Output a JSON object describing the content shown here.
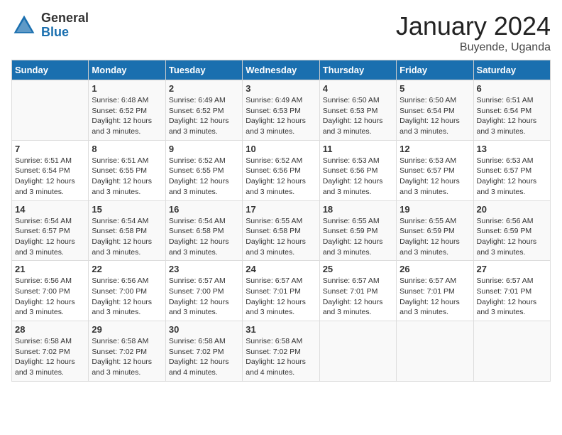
{
  "header": {
    "logo_general": "General",
    "logo_blue": "Blue",
    "month_year": "January 2024",
    "location": "Buyende, Uganda"
  },
  "days_of_week": [
    "Sunday",
    "Monday",
    "Tuesday",
    "Wednesday",
    "Thursday",
    "Friday",
    "Saturday"
  ],
  "weeks": [
    [
      {
        "day": "",
        "content": ""
      },
      {
        "day": "1",
        "content": "Sunrise: 6:48 AM\nSunset: 6:52 PM\nDaylight: 12 hours\nand 3 minutes."
      },
      {
        "day": "2",
        "content": "Sunrise: 6:49 AM\nSunset: 6:52 PM\nDaylight: 12 hours\nand 3 minutes."
      },
      {
        "day": "3",
        "content": "Sunrise: 6:49 AM\nSunset: 6:53 PM\nDaylight: 12 hours\nand 3 minutes."
      },
      {
        "day": "4",
        "content": "Sunrise: 6:50 AM\nSunset: 6:53 PM\nDaylight: 12 hours\nand 3 minutes."
      },
      {
        "day": "5",
        "content": "Sunrise: 6:50 AM\nSunset: 6:54 PM\nDaylight: 12 hours\nand 3 minutes."
      },
      {
        "day": "6",
        "content": "Sunrise: 6:51 AM\nSunset: 6:54 PM\nDaylight: 12 hours\nand 3 minutes."
      }
    ],
    [
      {
        "day": "7",
        "content": "Sunrise: 6:51 AM\nSunset: 6:54 PM\nDaylight: 12 hours\nand 3 minutes."
      },
      {
        "day": "8",
        "content": "Sunrise: 6:51 AM\nSunset: 6:55 PM\nDaylight: 12 hours\nand 3 minutes."
      },
      {
        "day": "9",
        "content": "Sunrise: 6:52 AM\nSunset: 6:55 PM\nDaylight: 12 hours\nand 3 minutes."
      },
      {
        "day": "10",
        "content": "Sunrise: 6:52 AM\nSunset: 6:56 PM\nDaylight: 12 hours\nand 3 minutes."
      },
      {
        "day": "11",
        "content": "Sunrise: 6:53 AM\nSunset: 6:56 PM\nDaylight: 12 hours\nand 3 minutes."
      },
      {
        "day": "12",
        "content": "Sunrise: 6:53 AM\nSunset: 6:57 PM\nDaylight: 12 hours\nand 3 minutes."
      },
      {
        "day": "13",
        "content": "Sunrise: 6:53 AM\nSunset: 6:57 PM\nDaylight: 12 hours\nand 3 minutes."
      }
    ],
    [
      {
        "day": "14",
        "content": "Sunrise: 6:54 AM\nSunset: 6:57 PM\nDaylight: 12 hours\nand 3 minutes."
      },
      {
        "day": "15",
        "content": "Sunrise: 6:54 AM\nSunset: 6:58 PM\nDaylight: 12 hours\nand 3 minutes."
      },
      {
        "day": "16",
        "content": "Sunrise: 6:54 AM\nSunset: 6:58 PM\nDaylight: 12 hours\nand 3 minutes."
      },
      {
        "day": "17",
        "content": "Sunrise: 6:55 AM\nSunset: 6:58 PM\nDaylight: 12 hours\nand 3 minutes."
      },
      {
        "day": "18",
        "content": "Sunrise: 6:55 AM\nSunset: 6:59 PM\nDaylight: 12 hours\nand 3 minutes."
      },
      {
        "day": "19",
        "content": "Sunrise: 6:55 AM\nSunset: 6:59 PM\nDaylight: 12 hours\nand 3 minutes."
      },
      {
        "day": "20",
        "content": "Sunrise: 6:56 AM\nSunset: 6:59 PM\nDaylight: 12 hours\nand 3 minutes."
      }
    ],
    [
      {
        "day": "21",
        "content": "Sunrise: 6:56 AM\nSunset: 7:00 PM\nDaylight: 12 hours\nand 3 minutes."
      },
      {
        "day": "22",
        "content": "Sunrise: 6:56 AM\nSunset: 7:00 PM\nDaylight: 12 hours\nand 3 minutes."
      },
      {
        "day": "23",
        "content": "Sunrise: 6:57 AM\nSunset: 7:00 PM\nDaylight: 12 hours\nand 3 minutes."
      },
      {
        "day": "24",
        "content": "Sunrise: 6:57 AM\nSunset: 7:01 PM\nDaylight: 12 hours\nand 3 minutes."
      },
      {
        "day": "25",
        "content": "Sunrise: 6:57 AM\nSunset: 7:01 PM\nDaylight: 12 hours\nand 3 minutes."
      },
      {
        "day": "26",
        "content": "Sunrise: 6:57 AM\nSunset: 7:01 PM\nDaylight: 12 hours\nand 3 minutes."
      },
      {
        "day": "27",
        "content": "Sunrise: 6:57 AM\nSunset: 7:01 PM\nDaylight: 12 hours\nand 3 minutes."
      }
    ],
    [
      {
        "day": "28",
        "content": "Sunrise: 6:58 AM\nSunset: 7:02 PM\nDaylight: 12 hours\nand 3 minutes."
      },
      {
        "day": "29",
        "content": "Sunrise: 6:58 AM\nSunset: 7:02 PM\nDaylight: 12 hours\nand 3 minutes."
      },
      {
        "day": "30",
        "content": "Sunrise: 6:58 AM\nSunset: 7:02 PM\nDaylight: 12 hours\nand 4 minutes."
      },
      {
        "day": "31",
        "content": "Sunrise: 6:58 AM\nSunset: 7:02 PM\nDaylight: 12 hours\nand 4 minutes."
      },
      {
        "day": "",
        "content": ""
      },
      {
        "day": "",
        "content": ""
      },
      {
        "day": "",
        "content": ""
      }
    ]
  ]
}
